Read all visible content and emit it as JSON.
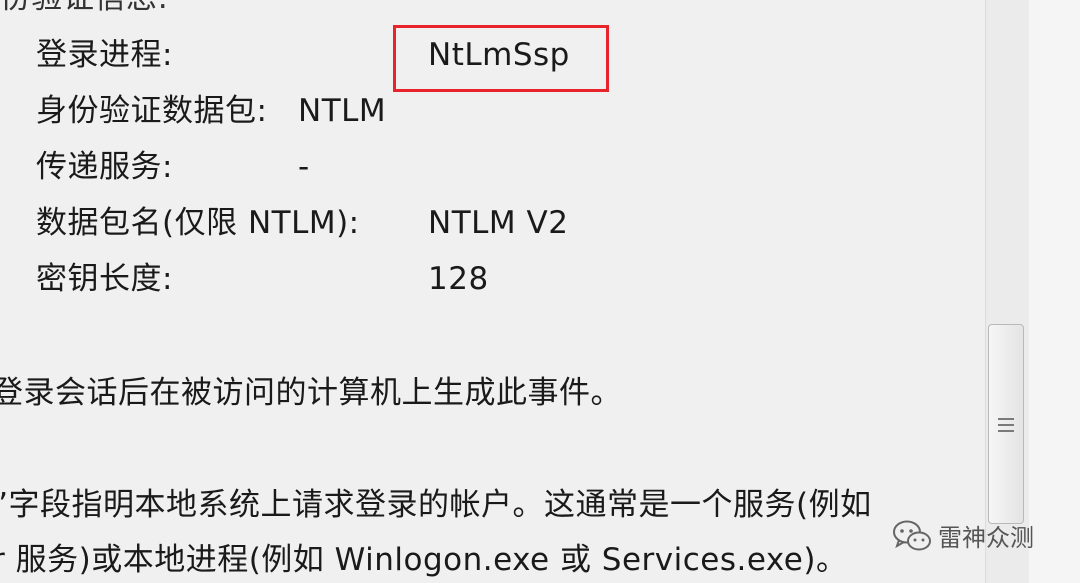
{
  "auth": {
    "heading_partial": "份验证信息:",
    "rows": [
      {
        "label": "登录进程:",
        "value": "NtLmSsp"
      },
      {
        "label": "身份验证数据包:",
        "value": "NTLM"
      },
      {
        "label": "传递服务:",
        "value": "-"
      },
      {
        "label": "数据包名(仅限 NTLM):",
        "value": "NTLM V2"
      },
      {
        "label": "密钥长度:",
        "value": "128"
      }
    ]
  },
  "description": {
    "line1": "登录会话后在被访问的计算机上生成此事件。",
    "line2": "”字段指明本地系统上请求登录的帐户。这通常是一个服务(例如",
    "line3": "r 服务)或本地进程(例如 Winlogon.exe 或 Services.exe)。"
  },
  "watermark": {
    "text": "雷神众测",
    "icon": "wechat-icon"
  },
  "colors": {
    "highlight": "#e8232a",
    "background": "#f0f0f0"
  }
}
